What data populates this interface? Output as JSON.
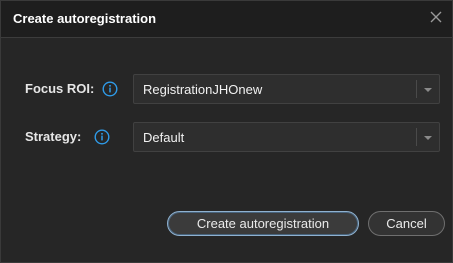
{
  "dialog": {
    "title": "Create autoregistration",
    "close_glyph": "×"
  },
  "fields": {
    "focus_roi": {
      "label": "Focus ROI:",
      "value": "RegistrationJHOnew"
    },
    "strategy": {
      "label": "Strategy:",
      "value": "Default"
    }
  },
  "buttons": {
    "create_label": "Create autoregistration",
    "cancel_label": "Cancel"
  },
  "colors": {
    "accent_info": "#2f9be8",
    "primary_border": "#8fb1cf"
  },
  "icons": {
    "info": "info-circle-icon",
    "close": "close-icon",
    "dropdown": "chevron-down-icon"
  }
}
